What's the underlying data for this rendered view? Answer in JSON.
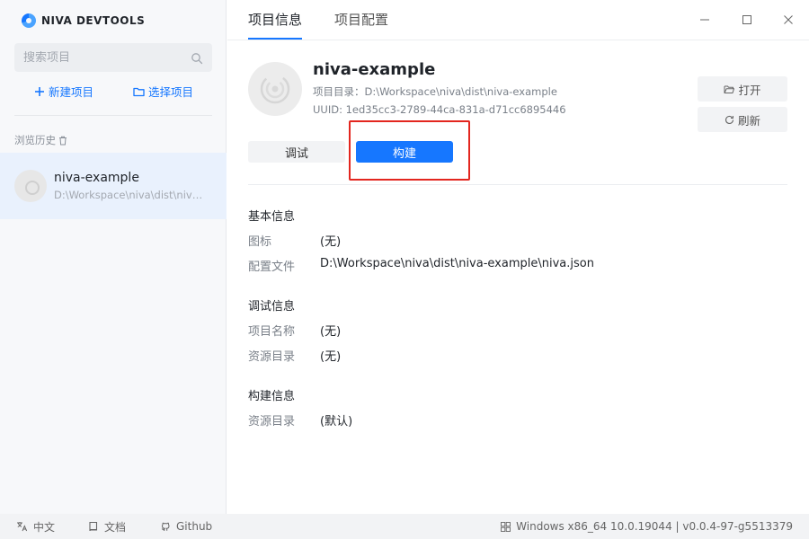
{
  "brand": {
    "name": "NIVA DEVTOOLS"
  },
  "sidebar": {
    "search_placeholder": "搜索项目",
    "new_project": "新建项目",
    "select_project": "选择项目",
    "history_title": "浏览历史",
    "history": [
      {
        "name": "niva-example",
        "path": "D:\\Workspace\\niva\\dist\\niva-example"
      }
    ]
  },
  "tabs": [
    {
      "label": "项目信息",
      "active": true
    },
    {
      "label": "项目配置",
      "active": false
    }
  ],
  "project": {
    "name": "niva-example",
    "dir_line": "项目目录：D:\\Workspace\\niva\\dist\\niva-example",
    "uuid_line": "UUID: 1ed35cc3-2789-44ca-831a-d71cc6895446",
    "open_button": "打开",
    "refresh_button": "刷新",
    "debug_button": "调试",
    "build_button": "构建"
  },
  "sections": {
    "basic": {
      "title": "基本信息",
      "rows": [
        {
          "label": "图标",
          "value": "(无)"
        },
        {
          "label": "配置文件",
          "value": "D:\\Workspace\\niva\\dist\\niva-example\\niva.json"
        }
      ]
    },
    "debug": {
      "title": "调试信息",
      "rows": [
        {
          "label": "项目名称",
          "value": "(无)"
        },
        {
          "label": "资源目录",
          "value": "(无)"
        }
      ]
    },
    "build": {
      "title": "构建信息",
      "rows": [
        {
          "label": "资源目录",
          "value": "(默认)"
        }
      ]
    }
  },
  "statusbar": {
    "language": "中文",
    "docs": "文档",
    "github": "Github",
    "version_info": "Windows x86_64 10.0.19044 | v0.0.4-97-g5513379"
  },
  "colors": {
    "accent": "#1677ff",
    "highlight": "#e3261f"
  },
  "icons": [
    "search-icon",
    "plus-icon",
    "folder-icon",
    "trash-icon",
    "minimize-icon",
    "maximize-icon",
    "close-icon",
    "folder-open-icon",
    "refresh-icon",
    "translate-icon",
    "book-icon",
    "github-icon",
    "windows-icon"
  ]
}
